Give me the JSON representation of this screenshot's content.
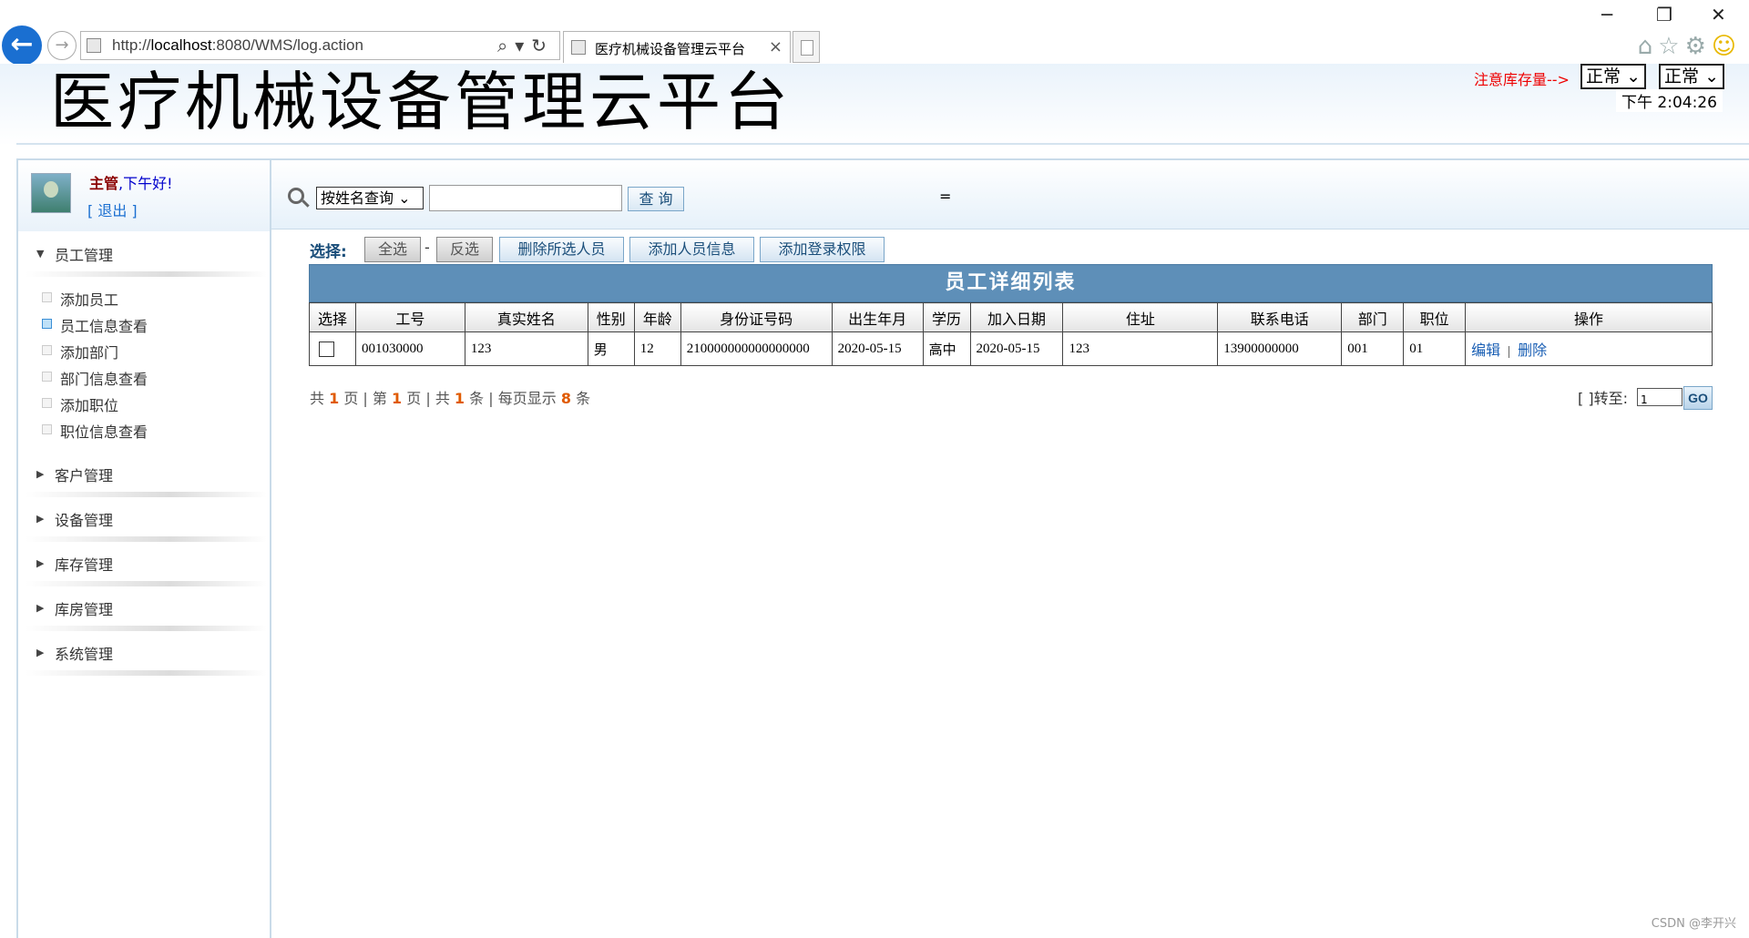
{
  "browser": {
    "url_prefix": "http://",
    "url_host": "localhost",
    "url_rest": ":8080/WMS/log.action",
    "tab_title": "医疗机械设备管理云平台",
    "tab_close": "×",
    "win_min": "─",
    "win_restore": "❐",
    "win_close": "✕",
    "back": "←",
    "forward": "→"
  },
  "header": {
    "title": "医疗机械设备管理云平台",
    "stock_label": "注意库存量-->",
    "status1": "正常",
    "status2": "正常",
    "clock": "下午 2:04:26"
  },
  "user": {
    "role": "主管",
    "greeting": ",下午好!",
    "logout": "[ 退出 ]"
  },
  "sidebar": {
    "groups": [
      {
        "label": "员工管理",
        "expanded": true
      },
      {
        "label": "客户管理"
      },
      {
        "label": "设备管理"
      },
      {
        "label": "库存管理"
      },
      {
        "label": "库房管理"
      },
      {
        "label": "系统管理"
      }
    ],
    "sub_items": [
      "添加员工",
      "员工信息查看",
      "添加部门",
      "部门信息查看",
      "添加职位",
      "职位信息查看"
    ],
    "active_item": "员工信息查看"
  },
  "search": {
    "mode": "按姓名查询",
    "input_value": "",
    "button": "查 询",
    "extra": "="
  },
  "actions": {
    "select_label": "选择:",
    "select_all": "全选",
    "dash": "-",
    "invert": "反选",
    "delete_selected": "删除所选人员",
    "add_person": "添加人员信息",
    "add_login": "添加登录权限"
  },
  "table": {
    "title": "员工详细列表",
    "headers": [
      "选择",
      "工号",
      "真实姓名",
      "性别",
      "年龄",
      "身份证号码",
      "出生年月",
      "学历",
      "加入日期",
      "住址",
      "联系电话",
      "部门",
      "职位",
      "操作"
    ],
    "rows": [
      {
        "id": "001030000",
        "name": "123",
        "gender": "男",
        "age": "12",
        "id_card": "210000000000000000",
        "birth": "2020-05-15",
        "education": "高中",
        "join_date": "2020-05-15",
        "address": "123",
        "phone": "13900000000",
        "dept": "001",
        "position": "01",
        "edit": "编辑",
        "op_sep": "|",
        "delete": "删除"
      }
    ]
  },
  "pager": {
    "t1": "共",
    "total_pages": "1",
    "t2": "页 | 第",
    "current_page": "1",
    "t3": "页 | 共",
    "total_items": "1",
    "t4": "条 | 每页显示",
    "page_size": "8",
    "t5": "条",
    "goto_label": "[ ]转至:",
    "goto_value": "1",
    "go": "GO"
  },
  "watermark": "CSDN @李开兴"
}
